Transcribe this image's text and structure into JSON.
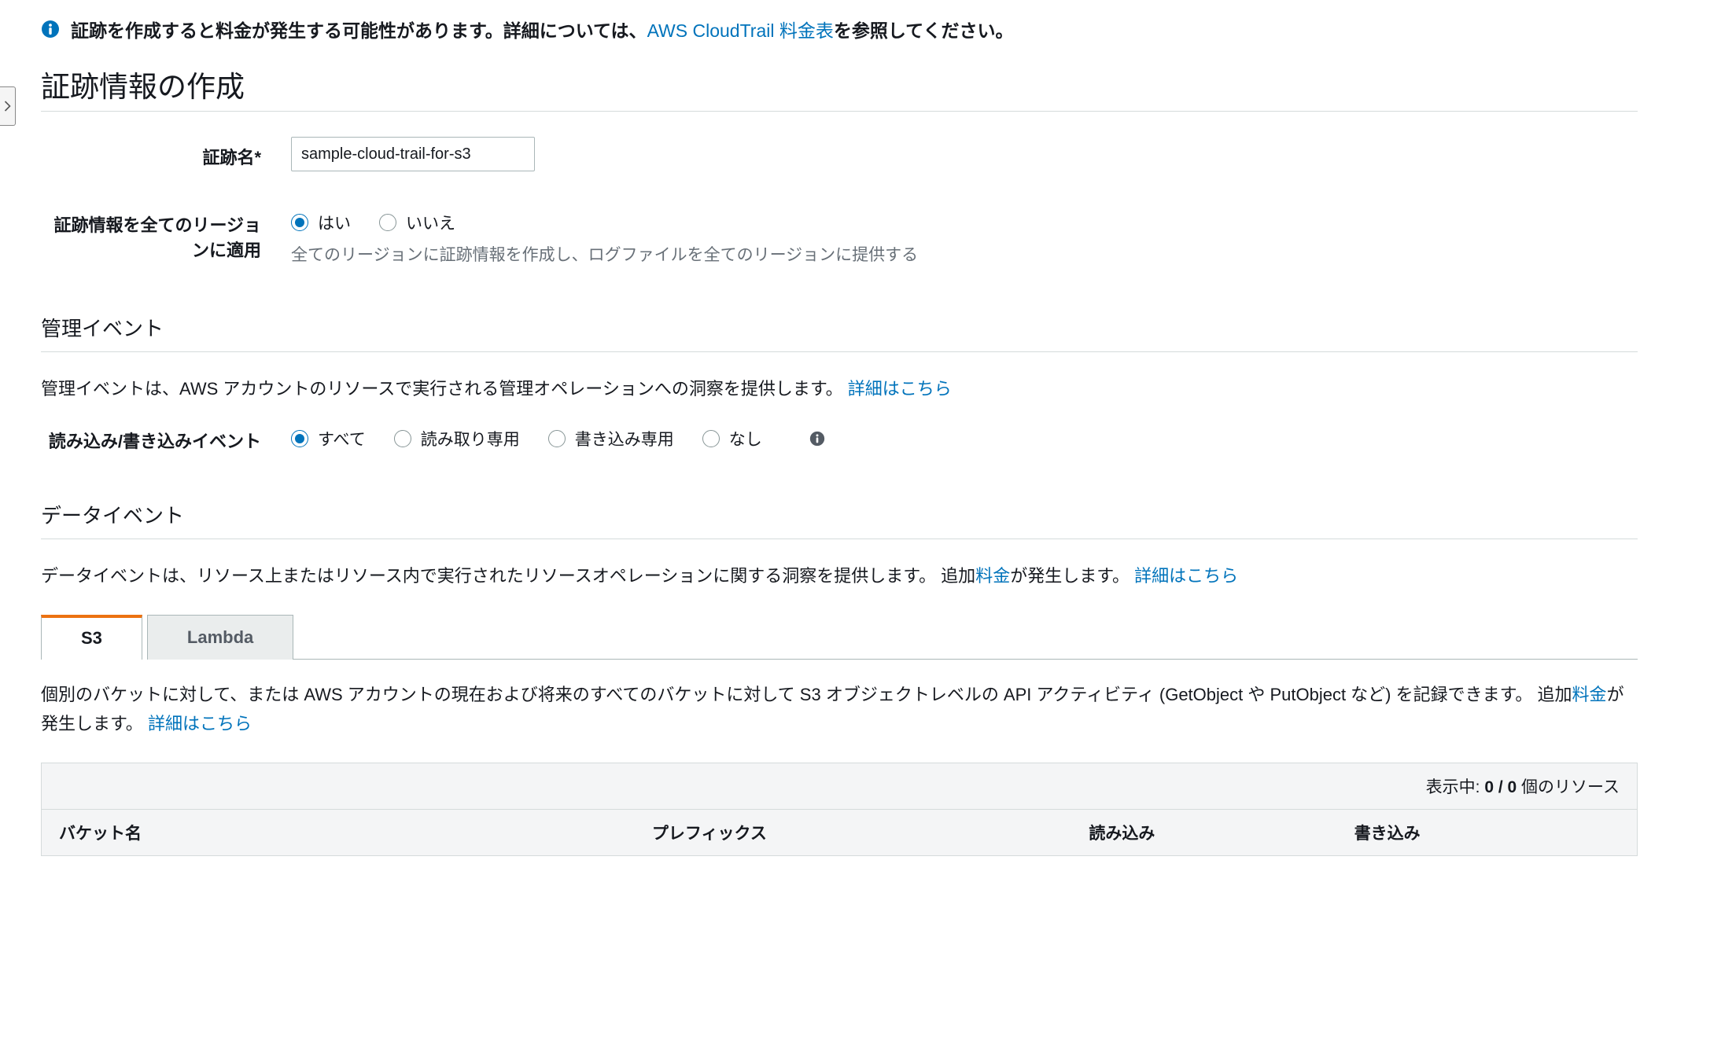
{
  "info_banner": {
    "pre": "証跡を作成すると料金が発生する可能性があります。詳細については、",
    "link": "AWS CloudTrail 料金表",
    "post": "を参照してください。"
  },
  "page_title": "証跡情報の作成",
  "trail_name": {
    "label": "証跡名*",
    "value": "sample-cloud-trail-for-s3"
  },
  "all_regions": {
    "label": "証跡情報を全てのリージョンに適用",
    "yes": "はい",
    "no": "いいえ",
    "hint": "全てのリージョンに証跡情報を作成し、ログファイルを全てのリージョンに提供する"
  },
  "mgmt": {
    "head": "管理イベント",
    "desc": "管理イベントは、AWS アカウントのリソースで実行される管理オペレーションへの洞察を提供します。",
    "more": "詳細はこちら",
    "rw_label": "読み込み/書き込みイベント",
    "all": "すべて",
    "read": "読み取り専用",
    "write": "書き込み専用",
    "none": "なし"
  },
  "data": {
    "head": "データイベント",
    "desc_pre": "データイベントは、リソース上またはリソース内で実行されたリソースオペレーションに関する洞察を提供します。 追加",
    "pricing": "料金",
    "desc_post": "が発生します。",
    "more": "詳細はこちら",
    "tab_s3": "S3",
    "tab_lambda": "Lambda",
    "s3_desc_pre": "個別のバケットに対して、または AWS アカウントの現在および将来のすべてのバケットに対して S3 オブジェクトレベルの API アクティビティ (GetObject や PutObject など) を記録できます。 追加",
    "s3_desc_mid": "が発生します。",
    "display_pre": "表示中: ",
    "display_count": "0 / 0",
    "display_post": " 個のリソース",
    "col_bucket": "バケット名",
    "col_prefix": "プレフィックス",
    "col_read": "読み込み",
    "col_write": "書き込み"
  }
}
